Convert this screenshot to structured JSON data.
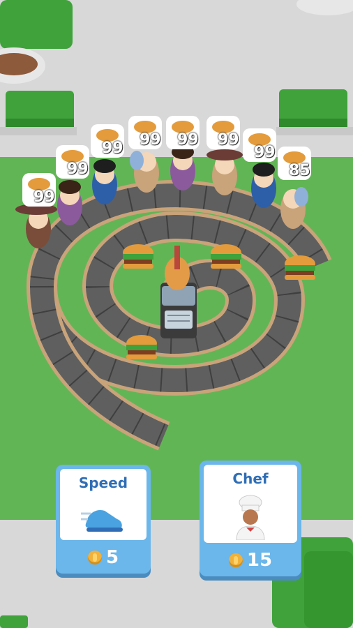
{
  "customers": [
    {
      "count": "99"
    },
    {
      "count": "99"
    },
    {
      "count": "99"
    },
    {
      "count": "99"
    },
    {
      "count": "99"
    },
    {
      "count": "99"
    },
    {
      "count": "99"
    },
    {
      "count": "85"
    }
  ],
  "upgrades": {
    "speed": {
      "title": "Speed",
      "cost": "5",
      "icon": "sneaker-icon"
    },
    "chef": {
      "title": "Chef",
      "cost": "15",
      "icon": "chef-icon"
    }
  },
  "colors": {
    "grass": "#62b555",
    "pavement": "#d8d8d8",
    "belt": "#5f5f5f",
    "belt_edge": "#c9a37a",
    "card": "#6bb6ea",
    "card_title": "#2f6eb6",
    "coin": "#f1b13a"
  }
}
